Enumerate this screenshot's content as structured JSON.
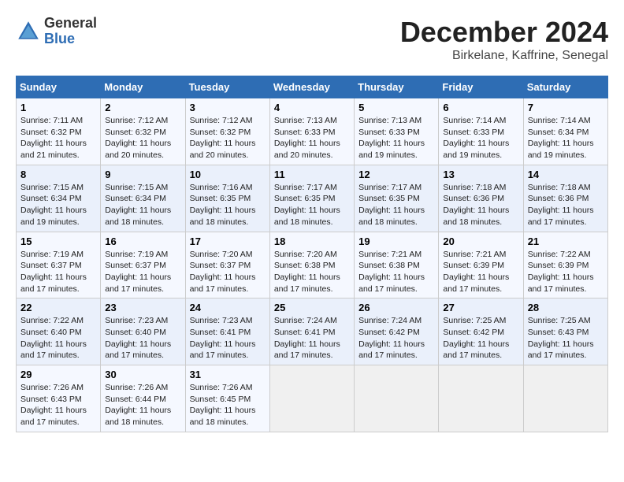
{
  "header": {
    "logo_general": "General",
    "logo_blue": "Blue",
    "month_title": "December 2024",
    "location": "Birkelane, Kaffrine, Senegal"
  },
  "columns": [
    "Sunday",
    "Monday",
    "Tuesday",
    "Wednesday",
    "Thursday",
    "Friday",
    "Saturday"
  ],
  "weeks": [
    [
      {
        "day": "1",
        "sunrise": "7:11 AM",
        "sunset": "6:32 PM",
        "daylight": "11 hours and 21 minutes."
      },
      {
        "day": "2",
        "sunrise": "7:12 AM",
        "sunset": "6:32 PM",
        "daylight": "11 hours and 20 minutes."
      },
      {
        "day": "3",
        "sunrise": "7:12 AM",
        "sunset": "6:32 PM",
        "daylight": "11 hours and 20 minutes."
      },
      {
        "day": "4",
        "sunrise": "7:13 AM",
        "sunset": "6:33 PM",
        "daylight": "11 hours and 20 minutes."
      },
      {
        "day": "5",
        "sunrise": "7:13 AM",
        "sunset": "6:33 PM",
        "daylight": "11 hours and 19 minutes."
      },
      {
        "day": "6",
        "sunrise": "7:14 AM",
        "sunset": "6:33 PM",
        "daylight": "11 hours and 19 minutes."
      },
      {
        "day": "7",
        "sunrise": "7:14 AM",
        "sunset": "6:34 PM",
        "daylight": "11 hours and 19 minutes."
      }
    ],
    [
      {
        "day": "8",
        "sunrise": "7:15 AM",
        "sunset": "6:34 PM",
        "daylight": "11 hours and 19 minutes."
      },
      {
        "day": "9",
        "sunrise": "7:15 AM",
        "sunset": "6:34 PM",
        "daylight": "11 hours and 18 minutes."
      },
      {
        "day": "10",
        "sunrise": "7:16 AM",
        "sunset": "6:35 PM",
        "daylight": "11 hours and 18 minutes."
      },
      {
        "day": "11",
        "sunrise": "7:17 AM",
        "sunset": "6:35 PM",
        "daylight": "11 hours and 18 minutes."
      },
      {
        "day": "12",
        "sunrise": "7:17 AM",
        "sunset": "6:35 PM",
        "daylight": "11 hours and 18 minutes."
      },
      {
        "day": "13",
        "sunrise": "7:18 AM",
        "sunset": "6:36 PM",
        "daylight": "11 hours and 18 minutes."
      },
      {
        "day": "14",
        "sunrise": "7:18 AM",
        "sunset": "6:36 PM",
        "daylight": "11 hours and 17 minutes."
      }
    ],
    [
      {
        "day": "15",
        "sunrise": "7:19 AM",
        "sunset": "6:37 PM",
        "daylight": "11 hours and 17 minutes."
      },
      {
        "day": "16",
        "sunrise": "7:19 AM",
        "sunset": "6:37 PM",
        "daylight": "11 hours and 17 minutes."
      },
      {
        "day": "17",
        "sunrise": "7:20 AM",
        "sunset": "6:37 PM",
        "daylight": "11 hours and 17 minutes."
      },
      {
        "day": "18",
        "sunrise": "7:20 AM",
        "sunset": "6:38 PM",
        "daylight": "11 hours and 17 minutes."
      },
      {
        "day": "19",
        "sunrise": "7:21 AM",
        "sunset": "6:38 PM",
        "daylight": "11 hours and 17 minutes."
      },
      {
        "day": "20",
        "sunrise": "7:21 AM",
        "sunset": "6:39 PM",
        "daylight": "11 hours and 17 minutes."
      },
      {
        "day": "21",
        "sunrise": "7:22 AM",
        "sunset": "6:39 PM",
        "daylight": "11 hours and 17 minutes."
      }
    ],
    [
      {
        "day": "22",
        "sunrise": "7:22 AM",
        "sunset": "6:40 PM",
        "daylight": "11 hours and 17 minutes."
      },
      {
        "day": "23",
        "sunrise": "7:23 AM",
        "sunset": "6:40 PM",
        "daylight": "11 hours and 17 minutes."
      },
      {
        "day": "24",
        "sunrise": "7:23 AM",
        "sunset": "6:41 PM",
        "daylight": "11 hours and 17 minutes."
      },
      {
        "day": "25",
        "sunrise": "7:24 AM",
        "sunset": "6:41 PM",
        "daylight": "11 hours and 17 minutes."
      },
      {
        "day": "26",
        "sunrise": "7:24 AM",
        "sunset": "6:42 PM",
        "daylight": "11 hours and 17 minutes."
      },
      {
        "day": "27",
        "sunrise": "7:25 AM",
        "sunset": "6:42 PM",
        "daylight": "11 hours and 17 minutes."
      },
      {
        "day": "28",
        "sunrise": "7:25 AM",
        "sunset": "6:43 PM",
        "daylight": "11 hours and 17 minutes."
      }
    ],
    [
      {
        "day": "29",
        "sunrise": "7:26 AM",
        "sunset": "6:43 PM",
        "daylight": "11 hours and 17 minutes."
      },
      {
        "day": "30",
        "sunrise": "7:26 AM",
        "sunset": "6:44 PM",
        "daylight": "11 hours and 18 minutes."
      },
      {
        "day": "31",
        "sunrise": "7:26 AM",
        "sunset": "6:45 PM",
        "daylight": "11 hours and 18 minutes."
      },
      null,
      null,
      null,
      null
    ]
  ]
}
